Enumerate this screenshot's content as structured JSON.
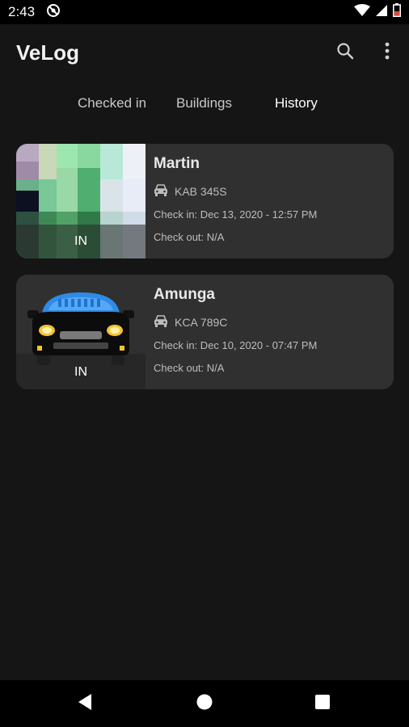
{
  "status_bar": {
    "time": "2:43"
  },
  "app_bar": {
    "title": "VeLog"
  },
  "tabs": [
    {
      "label": "Checked in"
    },
    {
      "label": "Buildings"
    },
    {
      "label": "History"
    }
  ],
  "records": [
    {
      "name": "Martin",
      "plate": "KAB 345S",
      "check_in": "Check in: Dec 13, 2020 - 12:57 PM",
      "check_out": "Check out: N/A",
      "status": "IN"
    },
    {
      "name": "Amunga",
      "plate": "KCA 789C",
      "check_in": "Check in: Dec 10, 2020 - 07:47 PM",
      "check_out": "Check out: N/A",
      "status": "IN"
    }
  ],
  "colors": {
    "background": "#151515",
    "card": "#303030",
    "car_roof": "#2e8be8"
  }
}
